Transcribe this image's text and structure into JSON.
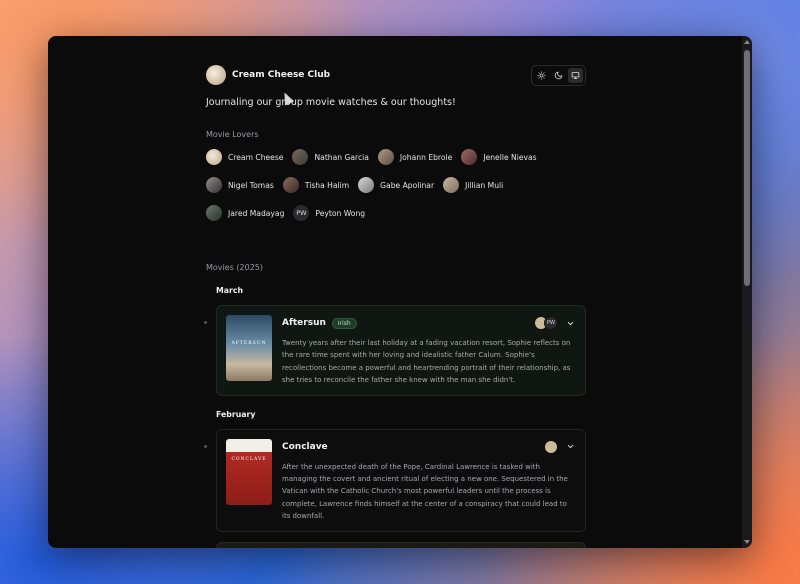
{
  "app": {
    "title": "Cream Cheese Club",
    "tagline": "Journaling our group movie watches & our thoughts!"
  },
  "theme_switch": {
    "options": [
      {
        "icon": "sun-icon",
        "active": false
      },
      {
        "icon": "moon-icon",
        "active": false
      },
      {
        "icon": "monitor-icon",
        "active": true
      }
    ]
  },
  "members_section": {
    "label": "Movie Lovers",
    "members": [
      {
        "name": "Cream Cheese",
        "initials": ""
      },
      {
        "name": "Nathan Garcia",
        "initials": ""
      },
      {
        "name": "Johann Ebrole",
        "initials": ""
      },
      {
        "name": "Jenelle Nievas",
        "initials": ""
      },
      {
        "name": "Nigel Tomas",
        "initials": ""
      },
      {
        "name": "Tisha Halim",
        "initials": ""
      },
      {
        "name": "Gabe Apolinar",
        "initials": ""
      },
      {
        "name": "Jillian Muli",
        "initials": ""
      },
      {
        "name": "Jared Madayag",
        "initials": ""
      },
      {
        "name": "Peyton Wong",
        "initials": "PW"
      }
    ]
  },
  "movies_section": {
    "label": "Movies (2025)",
    "groups": [
      {
        "month": "March",
        "movies": [
          {
            "title": "Aftersun",
            "badge": "Irish",
            "poster_text": "AFTERSUN",
            "viewers_initials": "PW",
            "description": "Twenty years after their last holiday at a fading vacation resort, Sophie reflects on the rare time spent with her loving and idealistic father Calum. Sophie's recollections become a powerful and heartrending portrait of their relationship, as she tries to reconcile the father she knew with the man she didn't."
          }
        ]
      },
      {
        "month": "February",
        "movies": [
          {
            "title": "Conclave",
            "badge": "",
            "poster_text": "CONCLAVE",
            "description": "After the unexpected death of the Pope, Cardinal Lawrence is tasked with managing the covert and ancient ritual of electing a new one. Sequestered in the Vatican with the Catholic Church's most powerful leaders until the process is complete, Lawrence finds himself at the center of a conspiracy that could lead to its downfall."
          }
        ]
      }
    ]
  }
}
